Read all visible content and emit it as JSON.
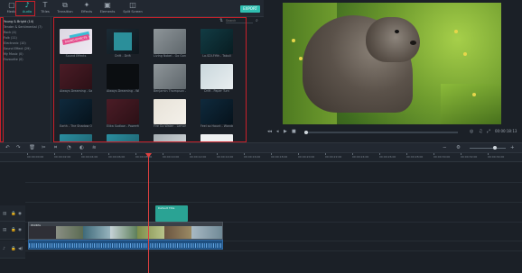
{
  "toolbar": {
    "items": [
      {
        "label": "Media",
        "icon": "folder-icon"
      },
      {
        "label": "Audio",
        "icon": "music-note-icon"
      },
      {
        "label": "Titles",
        "icon": "text-icon"
      },
      {
        "label": "Transition",
        "icon": "transition-icon"
      },
      {
        "label": "Effects",
        "icon": "effects-icon"
      },
      {
        "label": "Elements",
        "icon": "elements-icon"
      },
      {
        "label": "Split Screen",
        "icon": "split-screen-icon"
      }
    ],
    "export_label": "EXPORT"
  },
  "categories": [
    "Young & Bright (14)",
    "Tender & Sentimental (7)",
    "Rock (4)",
    "Folk (11)",
    "Electronic (10)",
    "Sound Effect (29)",
    "My Music (0)",
    "Favourite (0)"
  ],
  "library": {
    "search_placeholder": "Search",
    "tiles": [
      {
        "caption": "Sound Effects"
      },
      {
        "caption": "Drift - Drift"
      },
      {
        "caption": "Living Nobel - Go Gone"
      },
      {
        "caption": "La.SDI-Fifth - Tabuli"
      },
      {
        "caption": "Always Dreaming - Same"
      },
      {
        "caption": "Always Dreaming - Willi..."
      },
      {
        "caption": "Benjamin Thompson - Luc..."
      },
      {
        "caption": "Drift - Paper Turn"
      },
      {
        "caption": "Earth - The Shadow Of H..."
      },
      {
        "caption": "Elika Sudlow - Powerful F..."
      },
      {
        "caption": "Fire Go Water - Lemonad..."
      },
      {
        "caption": "Feel so Haunt - Wonderp..."
      },
      {
        "caption": ""
      },
      {
        "caption": ""
      },
      {
        "caption": ""
      },
      {
        "caption": ""
      }
    ],
    "first_tile_ribbon": "SOUND EFFECTS"
  },
  "preview": {
    "timecode": "00:00:18:13"
  },
  "timeline": {
    "ruler_ticks": [
      "00:00:00:00",
      "00:00:02:00",
      "00:00:04:00",
      "00:00:06:00",
      "00:00:08:00",
      "00:00:10:00",
      "00:00:12:00",
      "00:00:14:00",
      "00:00:16:00",
      "00:00:18:00",
      "00:00:20:00",
      "00:00:22:00",
      "00:00:24:00",
      "00:00:26:00",
      "00:00:28:00",
      "00:00:30:00",
      "00:00:32:00",
      "00:00:34:00"
    ],
    "title_clip_label": "Default Title",
    "video_clip_label": "Wildlife"
  },
  "colors": {
    "accent": "#39d5c8",
    "highlight_box": "#c9202a",
    "playhead": "#e04040"
  }
}
